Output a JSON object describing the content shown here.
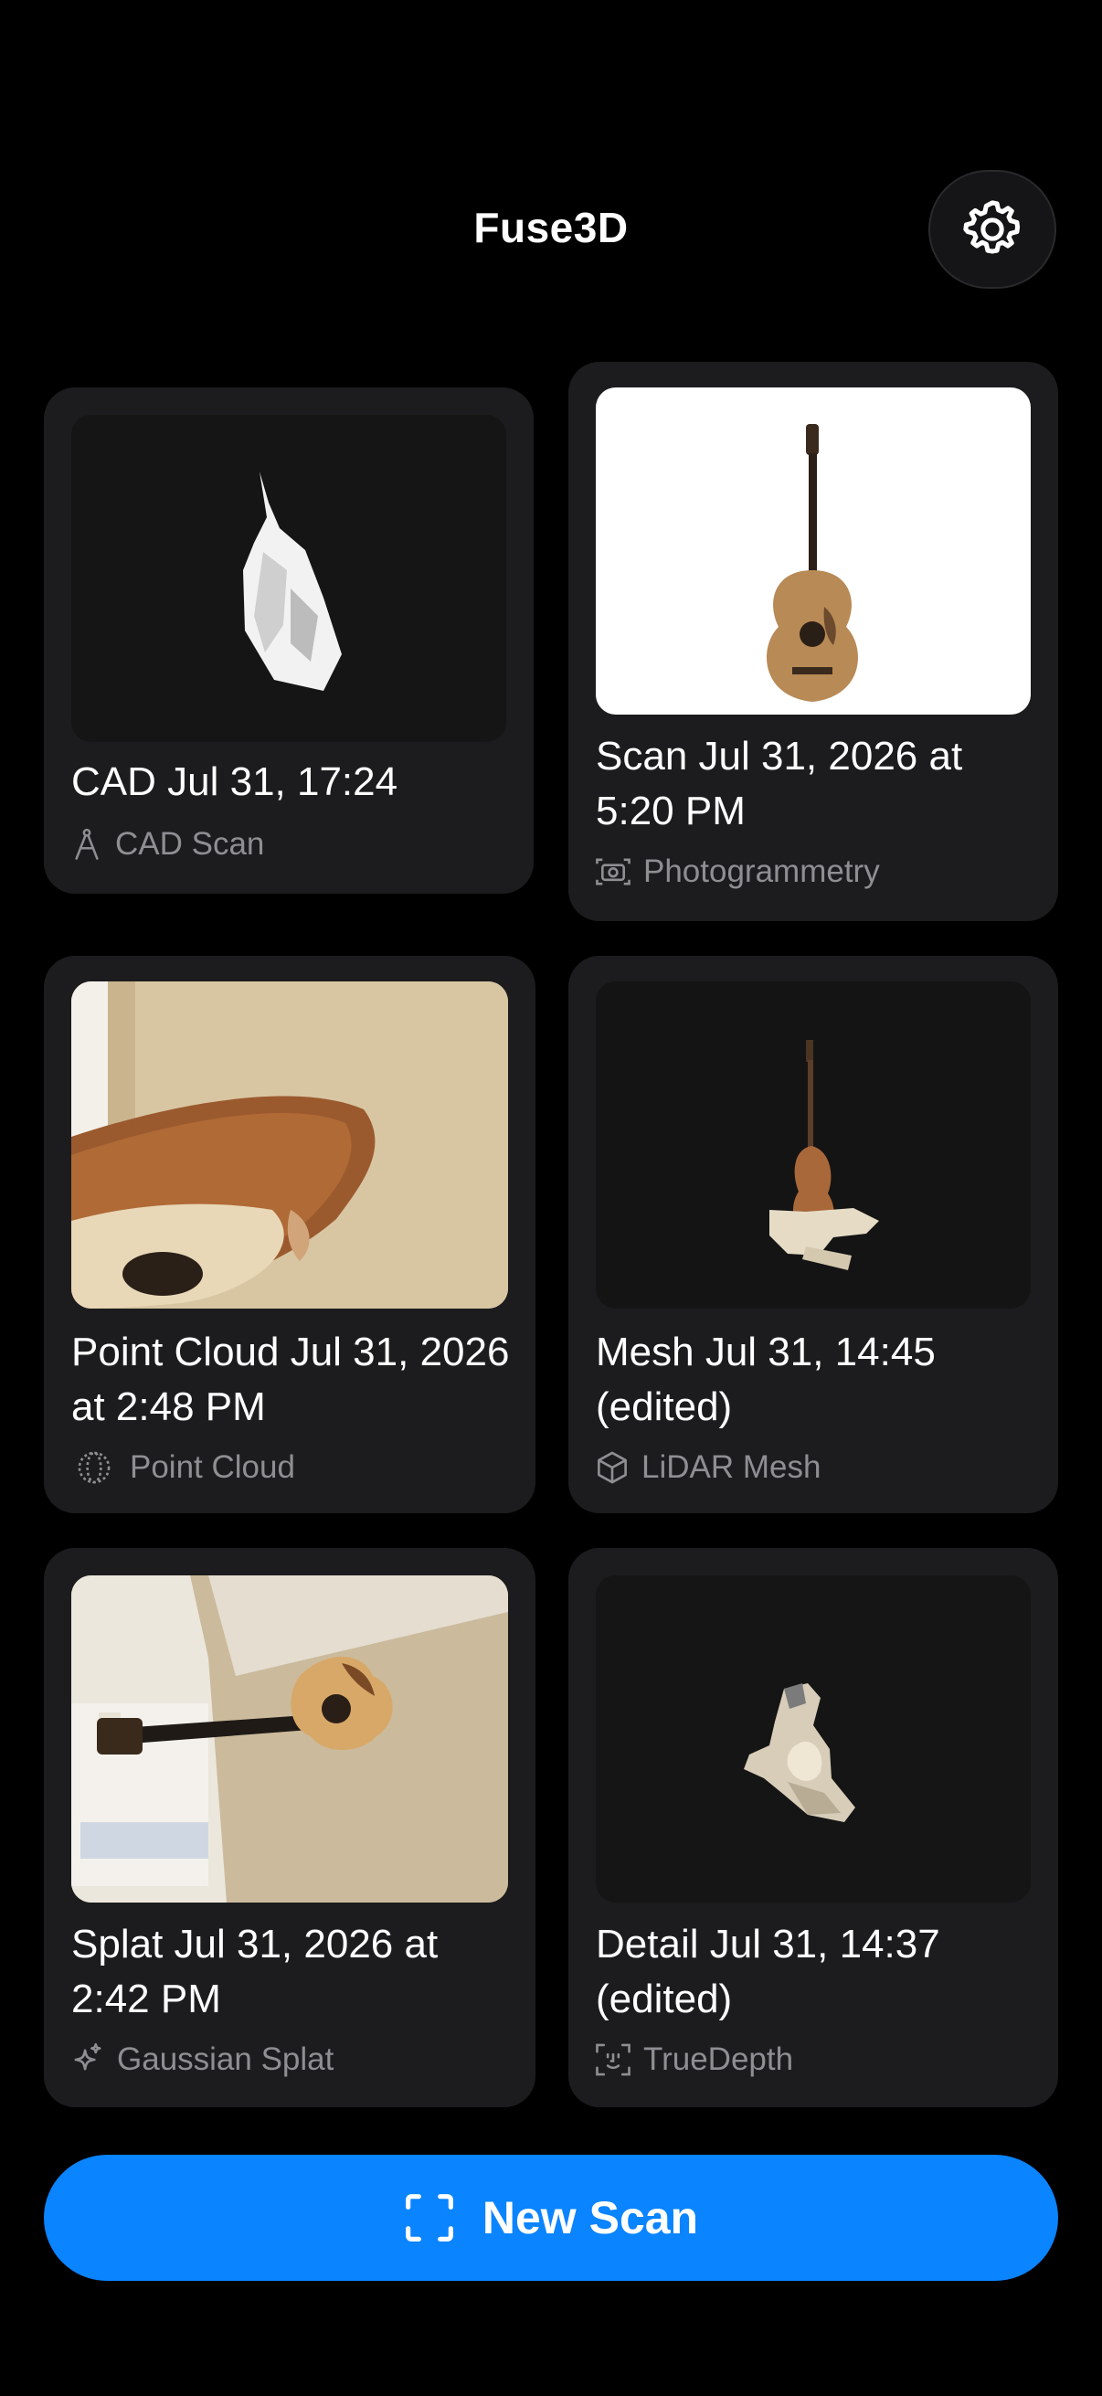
{
  "header": {
    "title": "Fuse3D"
  },
  "scans": [
    {
      "title": "CAD Jul 31, 17:24",
      "type_label": "CAD Scan",
      "type_icon": "compass-icon"
    },
    {
      "title": "Scan Jul 31, 2026 at 5:20 PM",
      "type_label": "Photogrammetry",
      "type_icon": "camera-icon"
    },
    {
      "title": "Point Cloud Jul 31, 2026 at 2:48 PM",
      "type_label": "Point Cloud",
      "type_icon": "point-cloud-icon"
    },
    {
      "title": "Mesh Jul 31, 14:45 (edited)",
      "type_label": "LiDAR Mesh",
      "type_icon": "cube-icon"
    },
    {
      "title": "Splat Jul 31, 2026 at 2:42 PM",
      "type_label": "Gaussian Splat",
      "type_icon": "sparkle-icon"
    },
    {
      "title": "Detail Jul 31, 14:37 (edited)",
      "type_label": "TrueDepth",
      "type_icon": "face-scan-icon"
    }
  ],
  "footer": {
    "new_scan_label": "New Scan"
  },
  "colors": {
    "accent": "#0a84ff",
    "card": "#1c1c1e",
    "background": "#000000"
  }
}
